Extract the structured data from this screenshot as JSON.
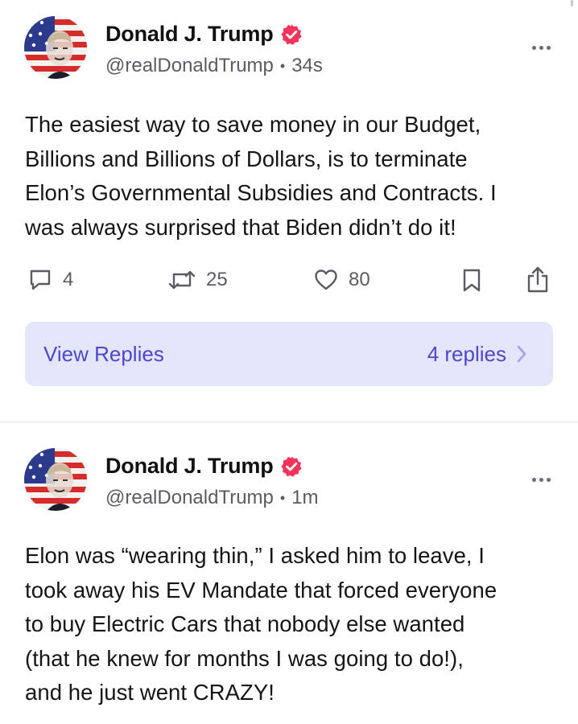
{
  "colors": {
    "accent": "#5145cd",
    "verified_badge": "#f6345b",
    "view_replies_bg": "#e4e6fb",
    "muted_text": "#5b5b63"
  },
  "posts": [
    {
      "author": "Donald J. Trump",
      "handle": "@realDonaldTrump",
      "separator": "•",
      "time": "34s",
      "lines": [
        "The easiest way to save money in our Budget,",
        "Billions and Billions of Dollars, is to terminate",
        "Elon’s Governmental Subsidies and Contracts. I",
        "was always surprised that Biden didn’t do it!"
      ],
      "reply_count": "4",
      "repost_count": "25",
      "like_count": "80",
      "view_replies_label": "View Replies",
      "replies_count_label": "4 replies"
    },
    {
      "author": "Donald J. Trump",
      "handle": "@realDonaldTrump",
      "separator": "•",
      "time": "1m",
      "lines": [
        "Elon was “wearing thin,” I asked him to leave, I",
        "took away his EV Mandate that forced everyone",
        "to buy Electric Cars that nobody else wanted",
        "(that he knew for months I was going to do!),",
        "and he just went CRAZY!"
      ]
    }
  ]
}
